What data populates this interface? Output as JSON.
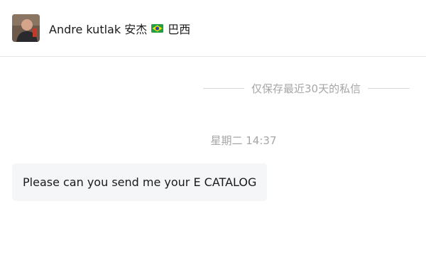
{
  "conversation": {
    "contact_name": "Andre kutlak 安杰",
    "contact_country": "巴西",
    "flag_icon": "brazil-flag-icon",
    "avatar_icon": "user-avatar-photo"
  },
  "notice": {
    "text": "仅保存最近30天的私信"
  },
  "messages": [
    {
      "timestamp": "星期二 14:37",
      "text": "Please can you send me your E CATALOG"
    }
  ],
  "colors": {
    "divider": "#e6e6e6",
    "muted_text": "#a6a6a6",
    "bubble_bg": "#f5f6f7",
    "primary_text": "#1a1a1a"
  }
}
